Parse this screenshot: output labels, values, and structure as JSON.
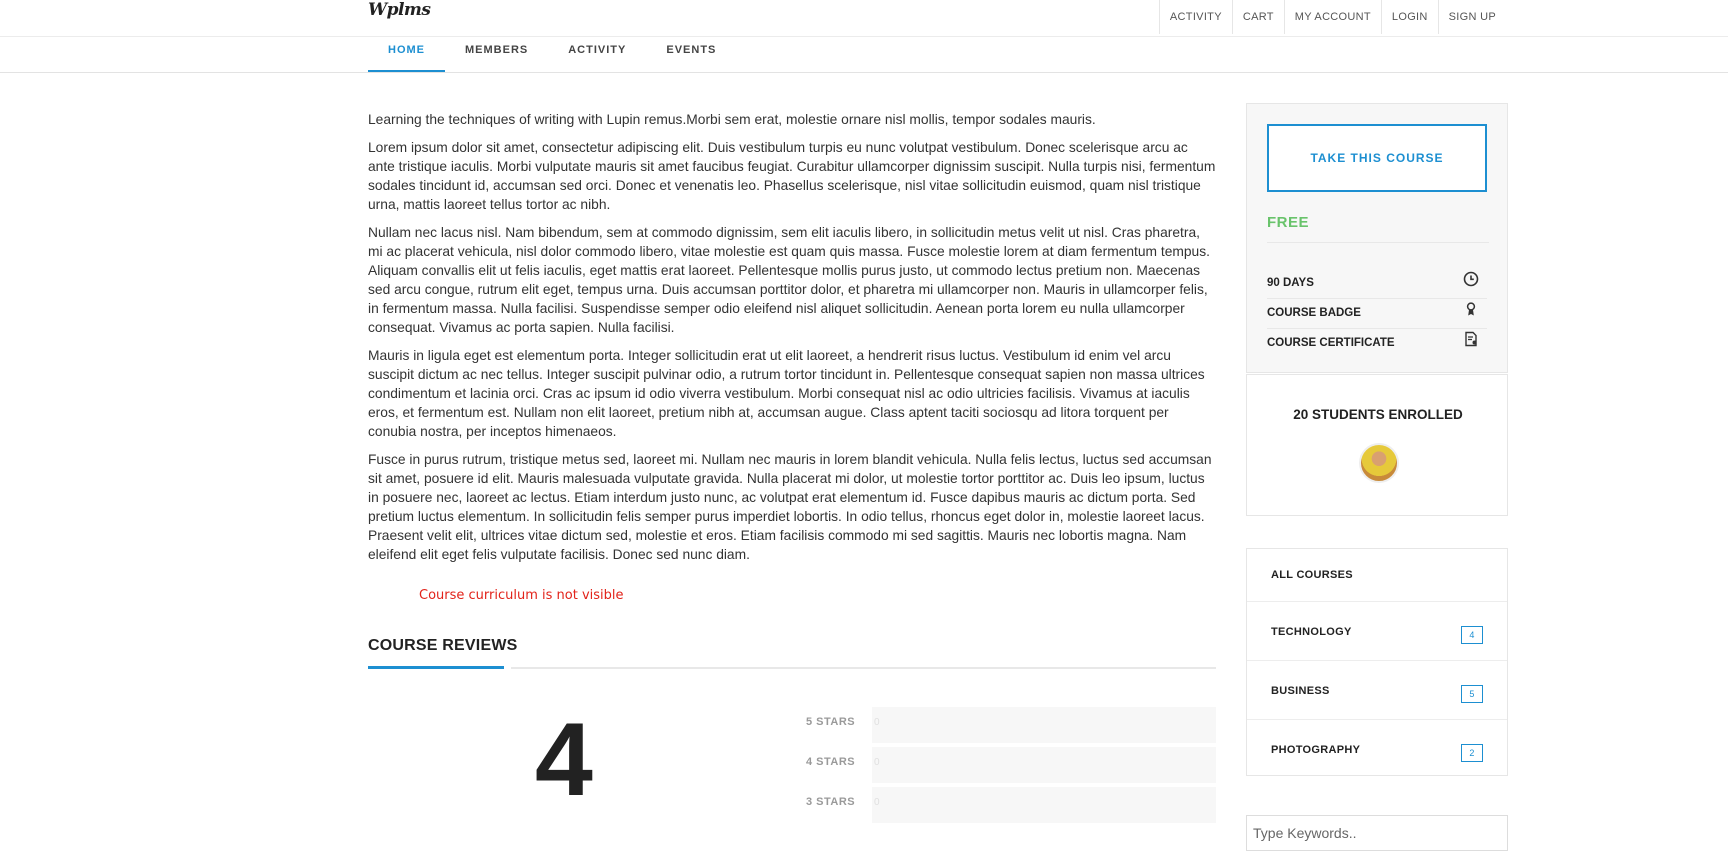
{
  "site": {
    "logo": "Wplms"
  },
  "toplinks": [
    "ACTIVITY",
    "CART",
    "MY ACCOUNT",
    "LOGIN",
    "SIGN UP"
  ],
  "nav": [
    {
      "label": "HOME",
      "active": true
    },
    {
      "label": "MEMBERS",
      "active": false
    },
    {
      "label": "ACTIVITY",
      "active": false
    },
    {
      "label": "EVENTS",
      "active": false
    }
  ],
  "description": [
    "Learning the techniques of writing with Lupin remus.Morbi sem erat, molestie ornare nisl mollis, tempor sodales mauris.",
    "Lorem ipsum dolor sit amet, consectetur adipiscing elit. Duis vestibulum turpis eu nunc volutpat vestibulum. Donec scelerisque arcu ac ante tristique iaculis. Morbi vulputate mauris sit amet faucibus feugiat. Curabitur ullamcorper dignissim suscipit. Nulla turpis nisi, fermentum sodales tincidunt id, accumsan sed orci. Donec et venenatis leo. Phasellus scelerisque, nisl vitae sollicitudin euismod, quam nisl tristique urna, mattis laoreet tellus tortor ac nibh.",
    "Nullam nec lacus nisl. Nam bibendum, sem at commodo dignissim, sem elit iaculis libero, in sollicitudin metus velit ut nisl. Cras pharetra, mi ac placerat vehicula, nisl dolor commodo libero, vitae molestie est quam quis massa. Fusce molestie lorem at diam fermentum tempus. Aliquam convallis elit ut felis iaculis, eget mattis erat laoreet. Pellentesque mollis purus justo, ut commodo lectus pretium non. Maecenas sed arcu congue, rutrum elit eget, tempus urna. Duis accumsan porttitor dolor, et pharetra mi ullamcorper non. Mauris in ullamcorper felis, in fermentum massa. Nulla facilisi. Suspendisse semper odio eleifend nisl aliquet sollicitudin. Aenean porta lorem eu nulla ullamcorper consequat. Vivamus ac porta sapien. Nulla facilisi.",
    "Mauris in ligula eget est elementum porta. Integer sollicitudin erat ut elit laoreet, a hendrerit risus luctus. Vestibulum id enim vel arcu suscipit dictum ac nec tellus. Integer suscipit pulvinar odio, a rutrum tortor tincidunt in. Pellentesque consequat sapien non massa ultrices condimentum et lacinia orci. Cras ac ipsum id odio viverra vestibulum. Morbi consequat nisl ac odio ultricies facilisis. Vivamus at iaculis eros, et fermentum est. Nullam non elit laoreet, pretium nibh at, accumsan augue. Class aptent taciti sociosqu ad litora torquent per conubia nostra, per inceptos himenaeos.",
    "Fusce in purus rutrum, tristique metus sed, laoreet mi. Nullam nec mauris in lorem blandit vehicula. Nulla felis lectus, luctus sed accumsan sit amet, posuere id elit. Mauris malesuada vulputate gravida. Nulla placerat mi dolor, ut molestie tortor porttitor ac. Duis leo ipsum, luctus in posuere nec, laoreet ac lectus. Etiam interdum justo nunc, ac volutpat erat elementum id. Fusce dapibus mauris ac dictum porta. Sed pretium luctus elementum. In sollicitudin felis semper purus imperdiet lobortis. In odio tellus, rhoncus eget dolor in, molestie laoreet lacus. Praesent velit elit, ultrices vitae dictum sed, molestie et eros. Etiam facilisis commodo mi sed sagittis. Mauris nec lobortis magna. Nam eleifend elit eget felis vulputate facilisis. Donec sed nunc diam."
  ],
  "curriculum_notice": "Course curriculum is not visible",
  "reviews": {
    "title": "COURSE REVIEWS",
    "average": "4",
    "rows": [
      {
        "label": "5 STARS",
        "count": "0"
      },
      {
        "label": "4 STARS",
        "count": "0"
      },
      {
        "label": "3 STARS",
        "count": "0"
      }
    ]
  },
  "sidebar": {
    "take_course": "TAKE THIS COURSE",
    "price": "FREE",
    "features": [
      {
        "label": "90 DAYS",
        "icon": "clock-icon"
      },
      {
        "label": "COURSE BADGE",
        "icon": "badge-icon"
      },
      {
        "label": "COURSE CERTIFICATE",
        "icon": "certificate-icon"
      }
    ],
    "enrolled": "20 STUDENTS ENROLLED",
    "categories": [
      {
        "name": "ALL COURSES",
        "count": ""
      },
      {
        "name": "TECHNOLOGY",
        "count": "4"
      },
      {
        "name": "BUSINESS",
        "count": "5"
      },
      {
        "name": "PHOTOGRAPHY",
        "count": "2"
      }
    ],
    "search_placeholder": "Type Keywords.."
  },
  "colors": {
    "accent": "#1d8fd1",
    "price": "#69c36b",
    "notice": "#e2231a"
  }
}
